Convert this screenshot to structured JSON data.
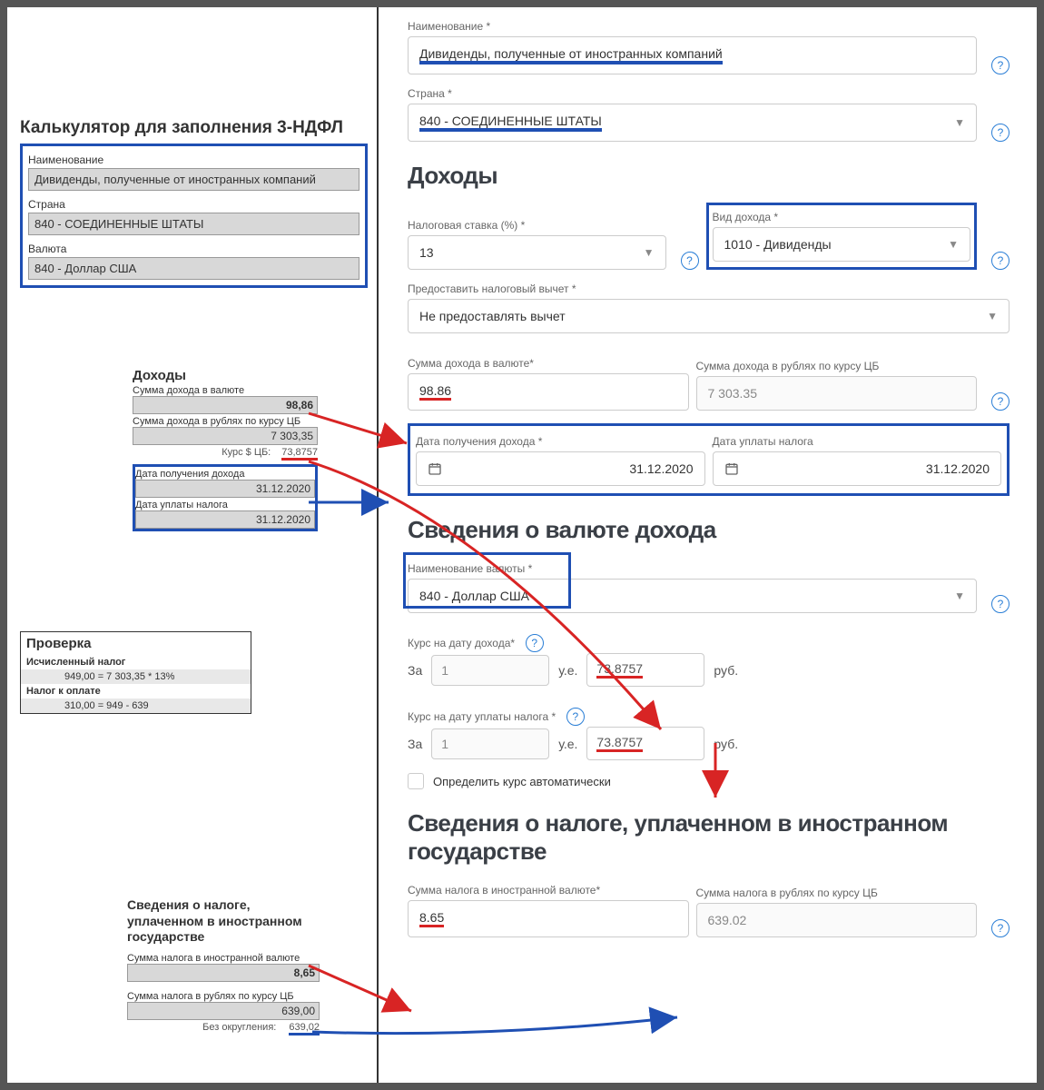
{
  "left": {
    "title": "Калькулятор для заполнения 3-НДФЛ",
    "name_label": "Наименование",
    "name_value": "Дивиденды, полученные от иностранных компаний",
    "country_label": "Страна",
    "country_value": "840 - СОЕДИНЕННЫЕ ШТАТЫ",
    "currency_label": "Валюта",
    "currency_value": "840 - Доллар США",
    "income_title": "Доходы",
    "sum_fc_label": "Сумма дохода в валюте",
    "sum_fc_value": "98,86",
    "sum_rub_label": "Сумма дохода в рублях по курсу ЦБ",
    "sum_rub_value": "7 303,35",
    "rate_label": "Курс $ ЦБ:",
    "rate_value": "73,8757",
    "date_income_label": "Дата получения дохода",
    "date_income_value": "31.12.2020",
    "date_tax_label": "Дата уплаты налога",
    "date_tax_value": "31.12.2020",
    "check_title": "Проверка",
    "check_calc_label": "Исчисленный налог",
    "check_calc_value": "949,00  =  7 303,35 * 13%",
    "check_due_label": "Налог к оплате",
    "check_due_value": "310,00  =  949 - 639",
    "ft_title": "Сведения о налоге, уплаченном в иностранном государстве",
    "ft_sum_fc_label": "Сумма налога в иностранной валюте",
    "ft_sum_fc_value": "8,65",
    "ft_sum_rub_label": "Сумма налога в рублях по курсу ЦБ",
    "ft_sum_rub_value": "639,00",
    "ft_note_label": "Без округления:",
    "ft_note_value": "639,02"
  },
  "right": {
    "name_label": "Наименование *",
    "name_value": "Дивиденды, полученные от иностранных компаний",
    "country_label": "Страна *",
    "country_value": "840 - СОЕДИНЕННЫЕ ШТАТЫ",
    "income_title": "Доходы",
    "tax_rate_label": "Налоговая ставка (%) *",
    "tax_rate_value": "13",
    "income_type_label": "Вид дохода *",
    "income_type_value": "1010 - Дивиденды",
    "deduction_label": "Предоставить налоговый вычет *",
    "deduction_value": "Не предоставлять вычет",
    "sum_fc_label": "Сумма дохода в валюте*",
    "sum_fc_value": "98.86",
    "sum_rub_label": "Сумма дохода в рублях по курсу ЦБ",
    "sum_rub_value": "7 303.35",
    "date_income_label": "Дата получения дохода *",
    "date_income_value": "31.12.2020",
    "date_tax_label": "Дата уплаты налога",
    "date_tax_value": "31.12.2020",
    "curr_title": "Сведения о валюте дохода",
    "curr_name_label": "Наименование валюты *",
    "curr_name_value": "840 - Доллар США",
    "rate_income_label": "Курс на дату дохода*",
    "rate_tax_label": "Курс на дату уплаты налога *",
    "za": "За",
    "one": "1",
    "ue": "у.е.",
    "rub": "руб.",
    "rate_income_value": "73.8757",
    "rate_tax_value": "73.8757",
    "auto_label": "Определить курс автоматически",
    "ft_title": "Сведения о налоге, уплаченном в иностранном государстве",
    "ft_sum_fc_label": "Сумма налога в иностранной валюте*",
    "ft_sum_fc_value": "8.65",
    "ft_sum_rub_label": "Сумма налога в рублях по курсу ЦБ",
    "ft_sum_rub_value": "639.02"
  }
}
